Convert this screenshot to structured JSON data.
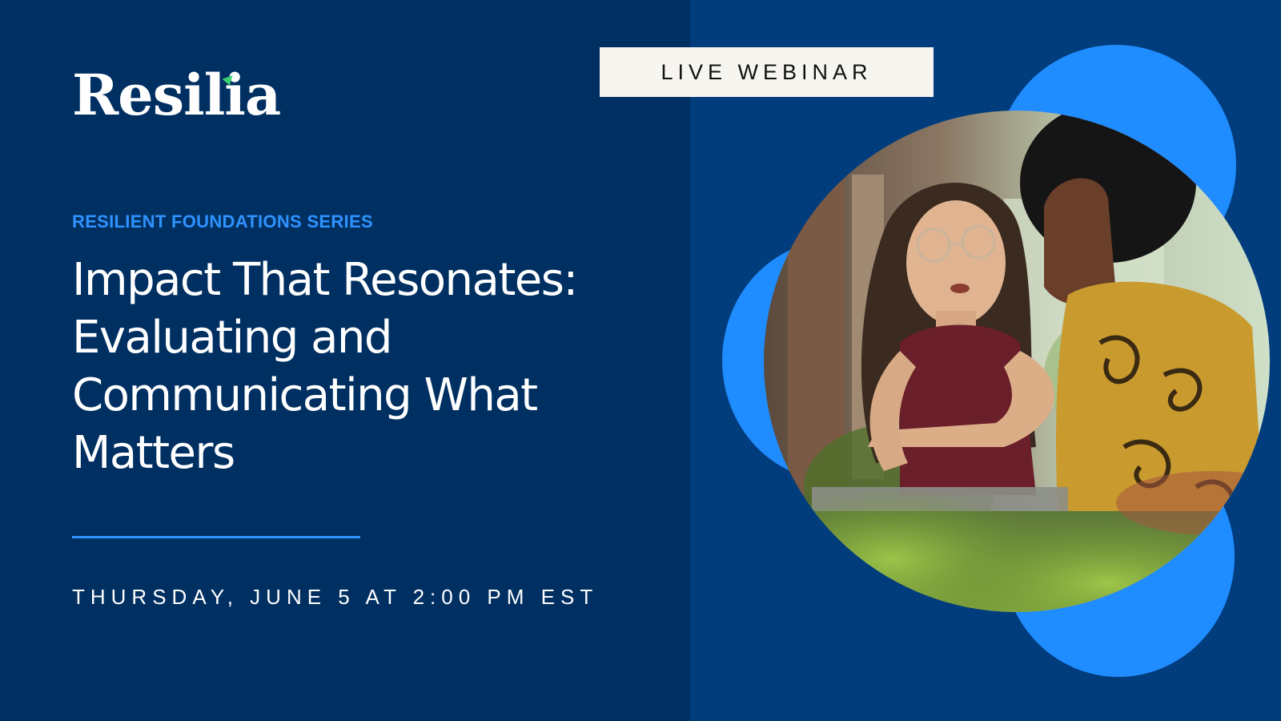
{
  "brand": {
    "name": "Resilia",
    "accent_color": "#3bd16f"
  },
  "badge": {
    "label": "LIVE WEBINAR"
  },
  "series": {
    "label": "RESILIENT FOUNDATIONS SERIES"
  },
  "title": {
    "line1": "Impact That Resonates:",
    "line2": "Evaluating and",
    "line3": "Communicating What",
    "line4": "Matters"
  },
  "event": {
    "date_text": "THURSDAY, JUNE 5 AT 2:00 PM EST"
  },
  "colors": {
    "left_bg": "#002f62",
    "right_bg": "#013c7c",
    "accent_blue": "#2f93ff",
    "blob_blue": "#1f8cff",
    "badge_bg": "#f7f5f0"
  },
  "image": {
    "subject": "two-women-conversation-photo"
  }
}
